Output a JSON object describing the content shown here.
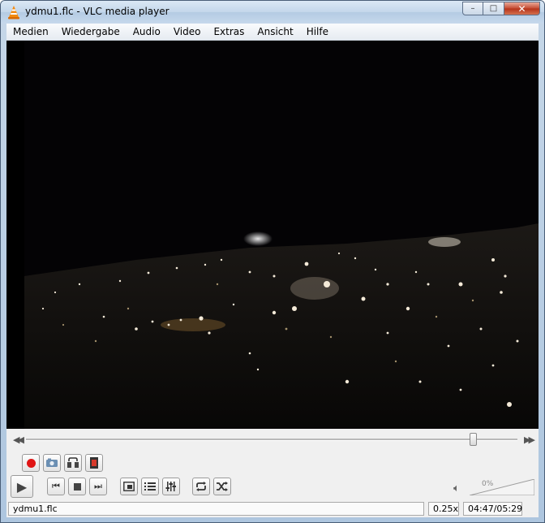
{
  "window": {
    "title": "ydmu1.flc - VLC media player"
  },
  "window_controls": {
    "minimize": "–",
    "maximize": "□",
    "close": "✕"
  },
  "menu": [
    "Medien",
    "Wiedergabe",
    "Audio",
    "Video",
    "Extras",
    "Ansicht",
    "Hilfe"
  ],
  "seek": {
    "position_fraction": 0.91,
    "back_glyph": "◀◀",
    "forward_glyph": "▶▶"
  },
  "icons": {
    "app": "vlc-cone-icon",
    "record": "record-icon",
    "snapshot": "snapshot-icon",
    "loop_ab": "loop-ab-icon",
    "frame_step": "frame-by-frame-icon",
    "play": "play-icon",
    "previous": "previous-icon",
    "stop": "stop-icon",
    "next": "next-icon",
    "fullscreen": "fullscreen-icon",
    "playlist": "playlist-icon",
    "extended_settings": "equalizer-icon",
    "loop": "loop-icon",
    "shuffle": "shuffle-icon",
    "volume": "speaker-icon"
  },
  "volume": {
    "label": "0%",
    "level": 0
  },
  "status": {
    "filename": "ydmu1.flc",
    "speed": "0.25x",
    "time": "04:47/05:29"
  },
  "colors": {
    "record": "#e01515",
    "window_frame": "#aec6df",
    "video_bg": "#000000"
  }
}
